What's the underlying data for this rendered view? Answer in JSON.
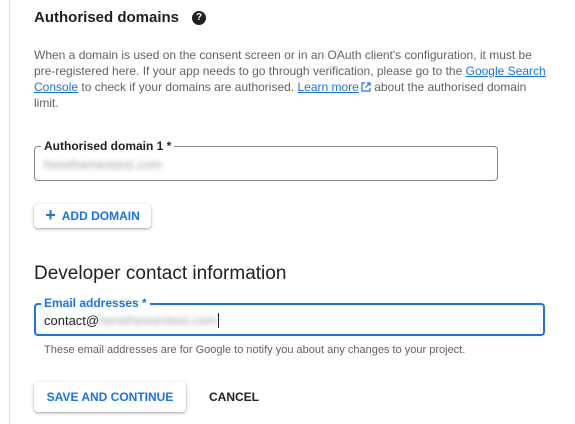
{
  "authorised_domains": {
    "title": "Authorised domains",
    "help_icon": "help-circle-icon",
    "description": {
      "part1": "When a domain is used on the consent screen or in an OAuth client's configuration, it must be pre-registered here. If your app needs to go through verification, please go to the ",
      "link1": "Google Search Console",
      "part2": " to check if your domains are authorised. ",
      "link2": "Learn more",
      "link2_icon": "external-link-icon",
      "part3": " about the authorised domain limit."
    },
    "domain_field": {
      "label": "Authorised domain 1 *",
      "value": "herethemestest.com"
    },
    "add_domain_button": {
      "icon": "plus-icon",
      "label": "ADD DOMAIN"
    }
  },
  "developer_contact": {
    "title": "Developer contact information",
    "email_field": {
      "label": "Email addresses *",
      "value_prefix": "contact@",
      "value_blurred": "herethemestest.com"
    },
    "hint": "These email addresses are for Google to notify you about any changes to your project."
  },
  "actions": {
    "save_label": "SAVE AND CONTINUE",
    "cancel_label": "CANCEL"
  },
  "colors": {
    "accent": "#1a73e8",
    "text": "#202124",
    "secondary_text": "#5f6368",
    "border": "#80868b"
  }
}
